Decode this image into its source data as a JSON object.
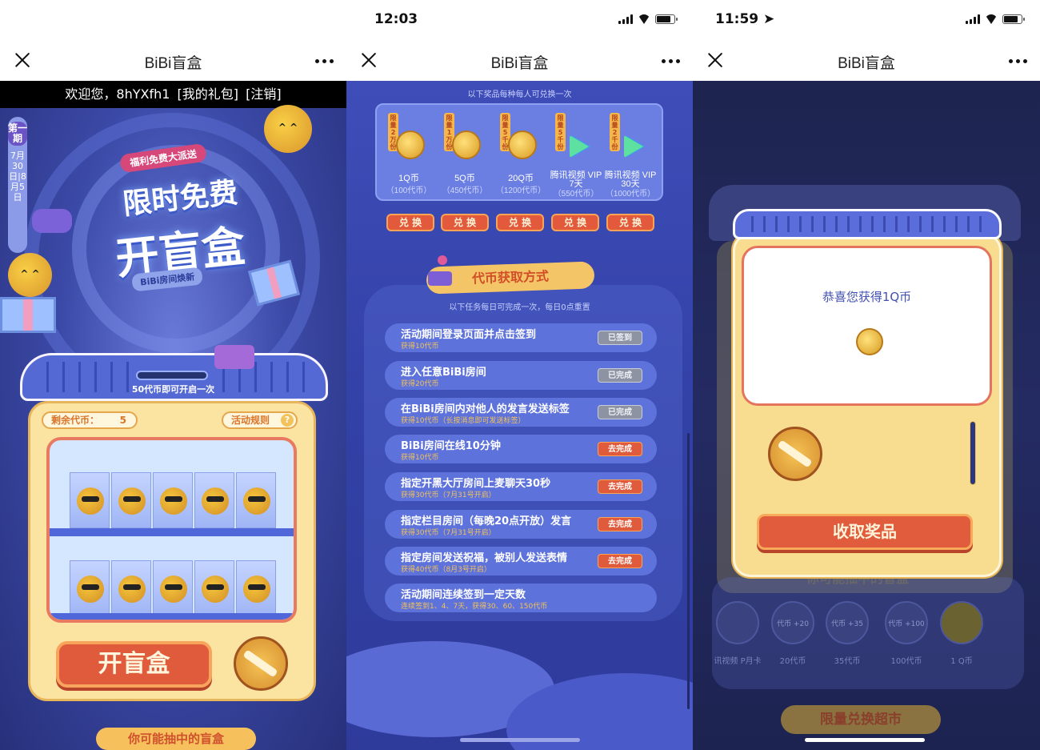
{
  "status": {
    "time_p2": "12:03",
    "time_p3": "11:59"
  },
  "nav": {
    "title": "BiBi盲盒"
  },
  "panel1": {
    "welcome": {
      "greeting": "欢迎您，8hYXfh1",
      "gift_link": "[我的礼包]",
      "logout_link": "[注销]"
    },
    "period": {
      "label": "第一期",
      "dates": "7月30日|8月5日"
    },
    "ribbon": "福利免费大派送",
    "title_line1": "限时免费",
    "title_line2": "开盲盒",
    "subtitle": "BiBi房间焕新",
    "machine_note": "50代币即可开启一次",
    "coins_label": "剩余代币：",
    "coins_value": "5",
    "rules_label": "活动规则",
    "open_button": "开盲盒",
    "bottom_tag": "你可能抽中的盲盒"
  },
  "panel2": {
    "exchange_note": "以下奖品每种每人可兑换一次",
    "prizes": [
      {
        "limit": "限量2万份",
        "name": "1Q币",
        "price": "（100代币）",
        "icon": "q-coin-icon"
      },
      {
        "limit": "限量1万份",
        "name": "5Q币",
        "price": "（450代币）",
        "icon": "q-coin-stack-icon"
      },
      {
        "limit": "限量5千份",
        "name": "20Q币",
        "price": "（1200代币）",
        "icon": "q-coin-pile-icon"
      },
      {
        "limit": "限量5千份",
        "name": "腾讯视频 VIP 7天",
        "price": "（550代币）",
        "icon": "tencent-video-icon"
      },
      {
        "limit": "限量2千份",
        "name": "腾讯视频 VIP 30天",
        "price": "（1000代币）",
        "icon": "tencent-video-icon"
      }
    ],
    "exchange_button": "兑 换",
    "section_title": "代币获取方式",
    "task_note": "以下任务每日可完成一次，每日0点重置",
    "tasks": [
      {
        "title": "活动期间登录页面并点击签到",
        "sub": "获得10代币",
        "button": "已签到",
        "state": "done"
      },
      {
        "title": "进入任意BiBi房间",
        "sub": "获得20代币",
        "button": "已完成",
        "state": "done"
      },
      {
        "title": "在BiBi房间内对他人的发言发送标签",
        "sub": "获得10代币（长按消息即可发送标签）",
        "button": "已完成",
        "state": "done"
      },
      {
        "title": "BiBi房间在线10分钟",
        "sub": "获得10代币",
        "button": "去完成",
        "state": "go"
      },
      {
        "title": "指定开黑大厅房间上麦聊天30秒",
        "sub": "获得30代币（7月31号开启）",
        "button": "去完成",
        "state": "go"
      },
      {
        "title": "指定栏目房间（每晚20点开放）发言",
        "sub": "获得30代币（7月31号开启）",
        "button": "去完成",
        "state": "go"
      },
      {
        "title": "指定房间发送祝福，被别人发送表情",
        "sub": "获得40代币（8月3号开启）",
        "button": "去完成",
        "state": "go"
      },
      {
        "title": "活动期间连续签到一定天数",
        "sub": "连续签到1、4、7天，获得30、60、150代币",
        "button": "",
        "state": "none"
      }
    ]
  },
  "panel3": {
    "modal_message": "恭喜您获得1Q币",
    "collect_button": "收取奖品",
    "bg_rewards": [
      {
        "label": "讯视频 P月卡",
        "badge": ""
      },
      {
        "label": "20代币",
        "badge": "代币 +20"
      },
      {
        "label": "35代币",
        "badge": "代币 +35"
      },
      {
        "label": "100代币",
        "badge": "代币 +100"
      },
      {
        "label": "1 Q币",
        "badge": ""
      }
    ],
    "bg_tag": "限量兑换超市",
    "bg_heading": "你可能抽中的盲盒"
  },
  "colors": {
    "accent_orange": "#e05a3c",
    "machine_yellow": "#fbe3a2",
    "bg_blue": "#3f4db9"
  }
}
